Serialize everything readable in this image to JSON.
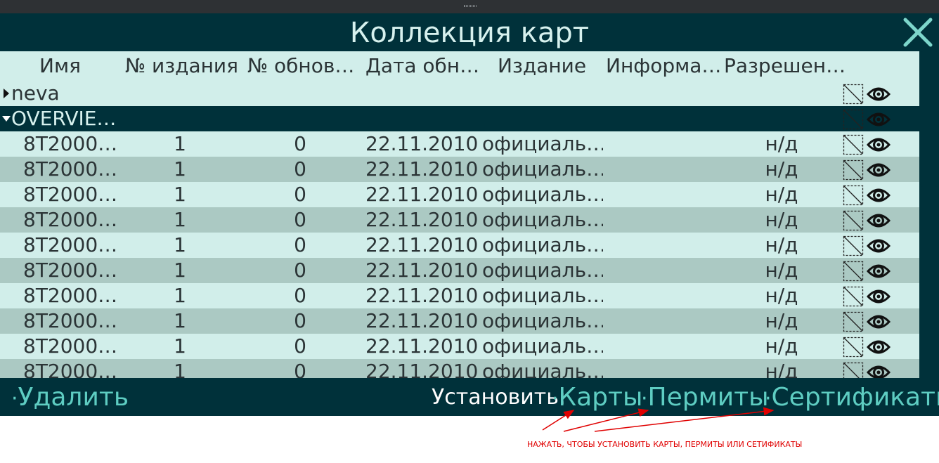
{
  "window": {
    "title": "Коллекция карт",
    "close_icon": "close-icon"
  },
  "table": {
    "columns": [
      "Имя",
      "№ издания",
      "№ обнов…",
      "Дата обн…",
      "Издание",
      "Информа…",
      "Разрешен…"
    ],
    "groups": [
      {
        "name": "neva",
        "expanded": false,
        "selected": false
      },
      {
        "name": "OVERVIE…",
        "expanded": true,
        "selected": true
      }
    ],
    "rows": [
      {
        "name": "8T2000…",
        "edition": "1",
        "update": "0",
        "date": "22.11.2010",
        "issue": "официаль…",
        "info": "",
        "permission": "н/д"
      },
      {
        "name": "8T2000…",
        "edition": "1",
        "update": "0",
        "date": "22.11.2010",
        "issue": "официаль…",
        "info": "",
        "permission": "н/д"
      },
      {
        "name": "8T2000…",
        "edition": "1",
        "update": "0",
        "date": "22.11.2010",
        "issue": "официаль…",
        "info": "",
        "permission": "н/д"
      },
      {
        "name": "8T2000…",
        "edition": "1",
        "update": "0",
        "date": "22.11.2010",
        "issue": "официаль…",
        "info": "",
        "permission": "н/д"
      },
      {
        "name": "8T2000…",
        "edition": "1",
        "update": "0",
        "date": "22.11.2010",
        "issue": "официаль…",
        "info": "",
        "permission": "н/д"
      },
      {
        "name": "8T2000…",
        "edition": "1",
        "update": "0",
        "date": "22.11.2010",
        "issue": "официаль…",
        "info": "",
        "permission": "н/д"
      },
      {
        "name": "8T2000…",
        "edition": "1",
        "update": "0",
        "date": "22.11.2010",
        "issue": "официаль…",
        "info": "",
        "permission": "н/д"
      },
      {
        "name": "8T2000…",
        "edition": "1",
        "update": "0",
        "date": "22.11.2010",
        "issue": "официаль…",
        "info": "",
        "permission": "н/д"
      },
      {
        "name": "8T2000…",
        "edition": "1",
        "update": "0",
        "date": "22.11.2010",
        "issue": "официаль…",
        "info": "",
        "permission": "н/д"
      },
      {
        "name": "8T2000…",
        "edition": "1",
        "update": "0",
        "date": "22.11.2010",
        "issue": "официаль…",
        "info": "",
        "permission": "н/д"
      }
    ],
    "row_icons": [
      "coverage-box-icon",
      "eye-icon"
    ]
  },
  "bottom": {
    "delete_label": "Удалить",
    "install_label": "Установить:",
    "charts_label": "Карты",
    "permits_label": "Пермиты",
    "certs_label": "Сертификаты",
    "bullet": "·"
  },
  "annotation": {
    "text": "НАЖАТЬ, ЧТОБЫ УСТАНОВИТЬ КАРТЫ, ПЕРМИТЫ ИЛИ СЕТИФИКАТЫ",
    "color": "#e00000"
  },
  "colors": {
    "dark_teal": "#00313a",
    "accent": "#5ecdc2",
    "row_light": "#d1eeea",
    "row_dark": "#abc9c3"
  }
}
